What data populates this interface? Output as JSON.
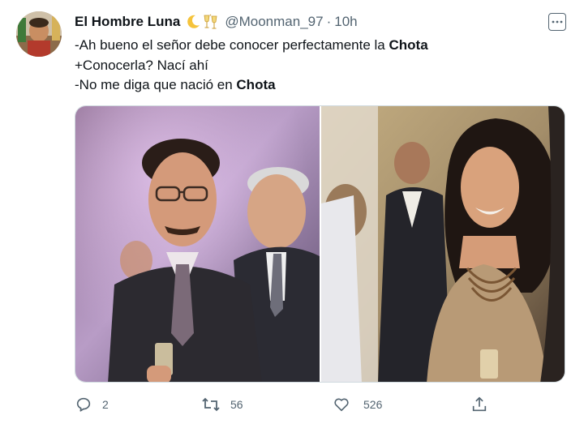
{
  "tweet": {
    "author_name": "El Hombre Luna",
    "author_emoji": "🌙🥂",
    "handle": "@Moonman_97",
    "separator": "·",
    "time": "10h",
    "lines": [
      {
        "text": "-Ah bueno el señor debe conocer perfectamente la ",
        "bold": "Chota"
      },
      {
        "text": "+Conocerla? Nací ahí",
        "bold": ""
      },
      {
        "text": "-No me diga que nació en ",
        "bold": "Chota"
      }
    ]
  },
  "actions": {
    "replies": "2",
    "retweets": "56",
    "likes": "526"
  },
  "icons": {
    "more": "more-icon",
    "reply": "reply-icon",
    "retweet": "retweet-icon",
    "like": "heart-icon",
    "share": "share-icon"
  },
  "colors": {
    "text": "#0f1419",
    "secondary": "#536471",
    "border": "#cfd9de"
  }
}
